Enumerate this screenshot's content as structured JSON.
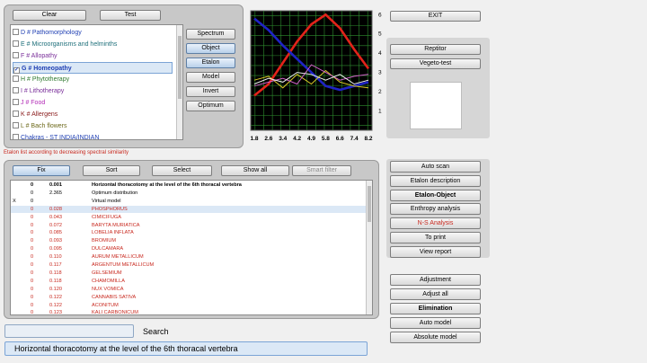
{
  "top_buttons": {
    "clear": "Clear",
    "test": "Test"
  },
  "categories": [
    {
      "label": "D # Pathomorphology",
      "color": "#1f3fb3",
      "checked": false
    },
    {
      "label": "E # Microorganisms and helminths",
      "color": "#1e6f7a",
      "checked": false
    },
    {
      "label": "F # Allopathy",
      "color": "#7a2f9a",
      "checked": false
    },
    {
      "label": "G # Homeopathy",
      "color": "#1f3fb3",
      "checked": true
    },
    {
      "label": "H # Phytotherapy",
      "color": "#2f7a2f",
      "checked": false
    },
    {
      "label": "I # Lithotherapy",
      "color": "#7a2f9a",
      "checked": false
    },
    {
      "label": "J # Food",
      "color": "#b22bb6",
      "checked": false
    },
    {
      "label": "K # Allergens",
      "color": "#8c2020",
      "checked": false
    },
    {
      "label": "L # Bach flowers",
      "color": "#6e6a1c",
      "checked": false
    },
    {
      "label": "Chakras - ST INDIA/INDIAN",
      "color": "#1f3fb3",
      "checked": false
    }
  ],
  "mode_buttons": [
    "Spectrum",
    "Object",
    "Etalon",
    "Model",
    "Invert",
    "Optimum"
  ],
  "chart_data": {
    "type": "line",
    "x": [
      1.8,
      2.6,
      3.4,
      4.2,
      4.9,
      5.8,
      6.6,
      7.4,
      8.2
    ],
    "x_ticks": [
      "1.8",
      "2.6",
      "3.4",
      "4.2",
      "4.9",
      "5.8",
      "6.6",
      "7.4",
      "8.2"
    ],
    "y_ticks": [
      "1",
      "2",
      "3",
      "4",
      "5",
      "6"
    ],
    "ylim": [
      0,
      6.2
    ],
    "grid": true,
    "series": [
      {
        "color": "#e2231a",
        "values": [
          1.8,
          2.4,
          3.5,
          4.6,
          5.5,
          6.0,
          5.3,
          4.2,
          3.2
        ]
      },
      {
        "color": "#1f24c6",
        "values": [
          5.8,
          5.2,
          4.4,
          3.7,
          3.0,
          2.3,
          2.1,
          2.3,
          2.5
        ]
      },
      {
        "color": "#d9c826",
        "values": [
          2.6,
          2.8,
          2.2,
          2.9,
          2.4,
          3.1,
          2.5,
          2.3,
          2.2
        ]
      },
      {
        "color": "#d060c8",
        "values": [
          2.3,
          2.5,
          2.7,
          2.4,
          3.4,
          3.0,
          2.6,
          2.8,
          2.9
        ]
      },
      {
        "color": "#efefef",
        "values": [
          2.4,
          2.7,
          2.5,
          3.0,
          2.9,
          2.6,
          2.9,
          2.4,
          2.6
        ]
      }
    ]
  },
  "right_buttons": {
    "exit": "EXIT",
    "reptitor": "Reptitor",
    "vegeto": "Vegeto-test"
  },
  "status_line": "Etalon list according to decreasing spectral similarity",
  "list_toolbar": {
    "fix": "Fix",
    "sort": "Sort",
    "select": "Select",
    "show_all": "Show all",
    "smart_filter": "Smart filter"
  },
  "rows": [
    {
      "c0": "0",
      "c1": "0.001",
      "c2": "Horizontal thoracotomy at the level of the 6th thoracal vertebra",
      "style": "bold",
      "mark": ""
    },
    {
      "c0": "0",
      "c1": "2.365",
      "c2": "Optimum distribution",
      "style": "normal",
      "mark": ""
    },
    {
      "c0": "0",
      "c1": "",
      "c2": "Virtual model",
      "style": "normal",
      "mark": "X"
    },
    {
      "c0": "0",
      "c1": "0.028",
      "c2": "PHOSPHORUS",
      "style": "red",
      "mark": "",
      "selected": true
    },
    {
      "c0": "0",
      "c1": "0.043",
      "c2": "CIMICIFUGA",
      "style": "red",
      "mark": ""
    },
    {
      "c0": "0",
      "c1": "0.072",
      "c2": "BARYTA MURIATICA",
      "style": "red",
      "mark": ""
    },
    {
      "c0": "0",
      "c1": "0.085",
      "c2": "LOBELIA INFLATA",
      "style": "red",
      "mark": ""
    },
    {
      "c0": "0",
      "c1": "0.093",
      "c2": "BROMIUM",
      "style": "red",
      "mark": ""
    },
    {
      "c0": "0",
      "c1": "0.095",
      "c2": "DULCAMARA",
      "style": "red",
      "mark": ""
    },
    {
      "c0": "0",
      "c1": "0.110",
      "c2": "AURUM METALLICUM",
      "style": "red",
      "mark": ""
    },
    {
      "c0": "0",
      "c1": "0.117",
      "c2": "ARGENTUM METALLICUM",
      "style": "red",
      "mark": ""
    },
    {
      "c0": "0",
      "c1": "0.118",
      "c2": "GELSEMIUM",
      "style": "red",
      "mark": ""
    },
    {
      "c0": "0",
      "c1": "0.118",
      "c2": "CHAMOMILLA",
      "style": "red",
      "mark": ""
    },
    {
      "c0": "0",
      "c1": "0.120",
      "c2": "NUX VOMICA",
      "style": "red",
      "mark": ""
    },
    {
      "c0": "0",
      "c1": "0.122",
      "c2": "CANNABIS SATIVA",
      "style": "red",
      "mark": ""
    },
    {
      "c0": "0",
      "c1": "0.122",
      "c2": "ACONITUM",
      "style": "red",
      "mark": ""
    },
    {
      "c0": "0",
      "c1": "0.123",
      "c2": "KALI CARBONICUM",
      "style": "red",
      "mark": ""
    }
  ],
  "search": {
    "value": "",
    "label": "Search"
  },
  "description": "Horizontal thoracotomy at the level of the 6th thoracal vertebra",
  "analysis_buttons": [
    {
      "label": "Auto scan",
      "style": ""
    },
    {
      "label": "Etalon description",
      "style": ""
    },
    {
      "label": "Etalon-Object",
      "style": "bold"
    },
    {
      "label": "Enthropy analysis",
      "style": ""
    },
    {
      "label": "N-S Analysis",
      "style": "red"
    },
    {
      "label": "To print",
      "style": ""
    },
    {
      "label": "View report",
      "style": ""
    }
  ],
  "model_buttons": [
    {
      "label": "Adjustment",
      "style": ""
    },
    {
      "label": "Adjust all",
      "style": ""
    },
    {
      "label": "Elimination",
      "style": "bold"
    },
    {
      "label": "Auto model",
      "style": ""
    },
    {
      "label": "Absolute model",
      "style": ""
    }
  ]
}
